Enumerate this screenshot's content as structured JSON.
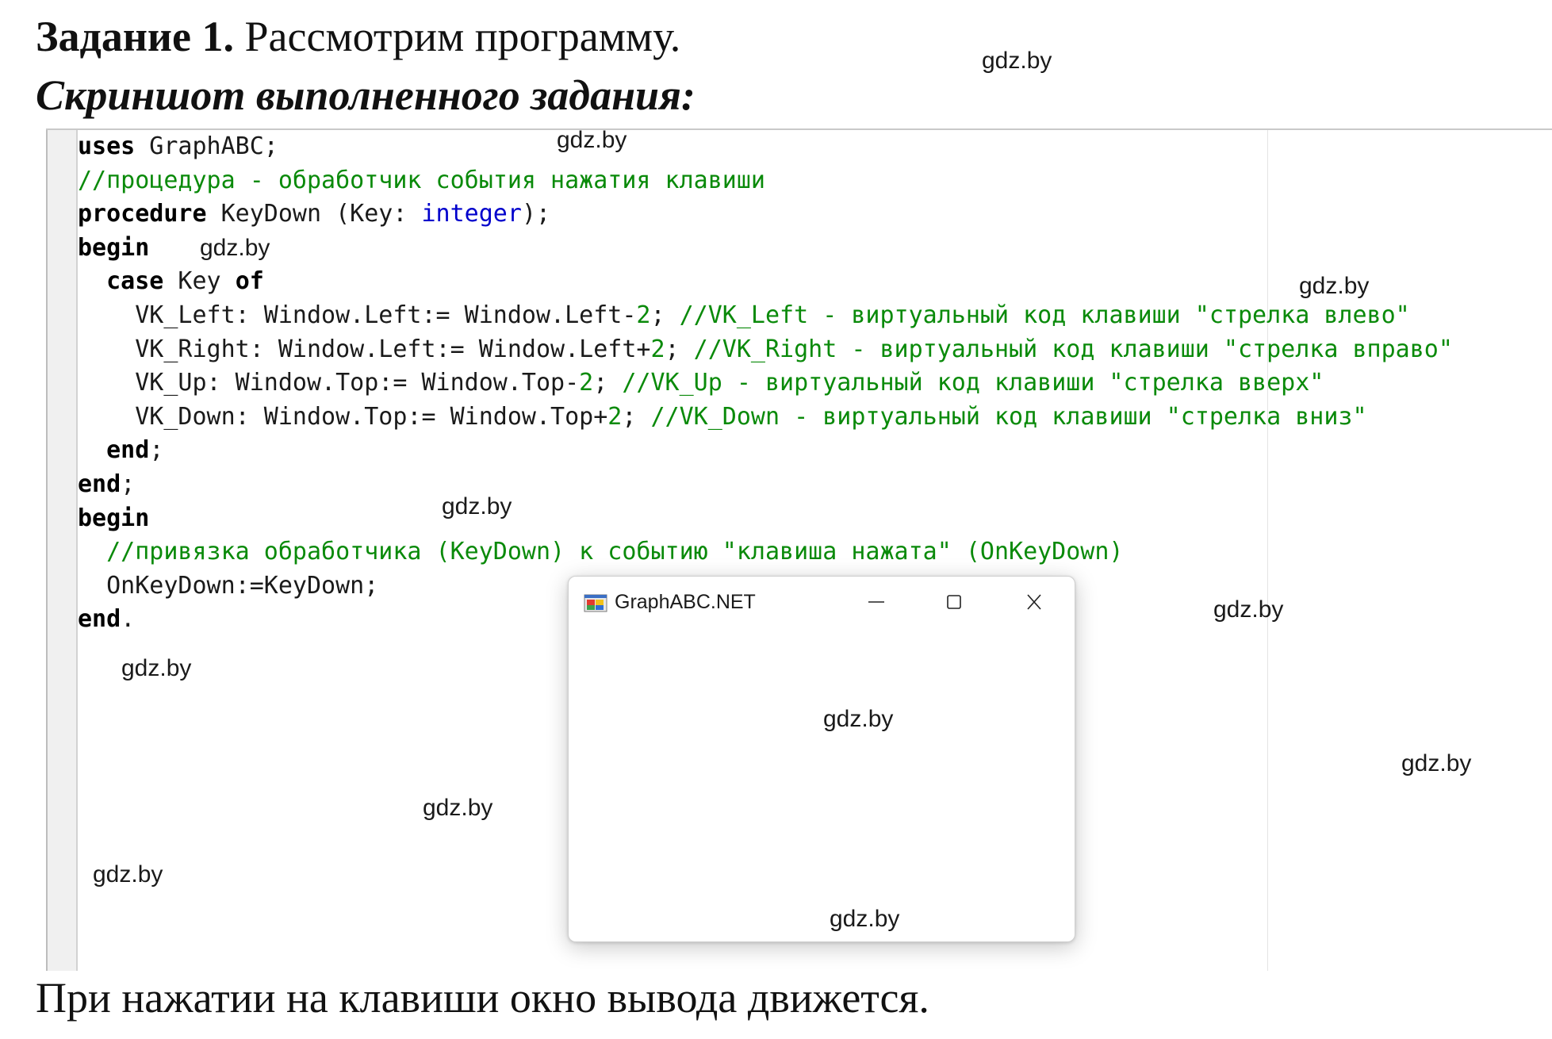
{
  "heading": {
    "task_label": "Задание 1.",
    "task_text": "Рассмотрим программу.",
    "screenshot_label": "Скриншот выполненного задания:"
  },
  "code_lines": [
    [
      {
        "t": "uses",
        "c": "kw"
      },
      {
        "t": " GraphABC;",
        "c": ""
      }
    ],
    [
      {
        "t": "//процедура - обработчик события нажатия клавиши",
        "c": "cm"
      }
    ],
    [
      {
        "t": "procedure",
        "c": "kw"
      },
      {
        "t": " KeyDown (Key: ",
        "c": ""
      },
      {
        "t": "integer",
        "c": "ty"
      },
      {
        "t": ");",
        "c": ""
      }
    ],
    [
      {
        "t": "begin",
        "c": "kw"
      }
    ],
    [
      {
        "t": "  ",
        "c": ""
      },
      {
        "t": "case",
        "c": "kw"
      },
      {
        "t": " Key ",
        "c": ""
      },
      {
        "t": "of",
        "c": "kw"
      }
    ],
    [
      {
        "t": "    VK_Left: Window.Left:= Window.Left-",
        "c": ""
      },
      {
        "t": "2",
        "c": "num"
      },
      {
        "t": "; ",
        "c": ""
      },
      {
        "t": "//VK_Left - виртуальный код клавиши \"стрелка влево\"",
        "c": "cm"
      }
    ],
    [
      {
        "t": "    VK_Right: Window.Left:= Window.Left+",
        "c": ""
      },
      {
        "t": "2",
        "c": "num"
      },
      {
        "t": "; ",
        "c": ""
      },
      {
        "t": "//VK_Right - виртуальный код клавиши \"стрелка вправо\"",
        "c": "cm"
      }
    ],
    [
      {
        "t": "    VK_Up: Window.Top:= Window.Top-",
        "c": ""
      },
      {
        "t": "2",
        "c": "num"
      },
      {
        "t": "; ",
        "c": ""
      },
      {
        "t": "//VK_Up - виртуальный код клавиши \"стрелка вверх\"",
        "c": "cm"
      }
    ],
    [
      {
        "t": "    VK_Down: Window.Top:= Window.Top+",
        "c": ""
      },
      {
        "t": "2",
        "c": "num"
      },
      {
        "t": "; ",
        "c": ""
      },
      {
        "t": "//VK_Down - виртуальный код клавиши \"стрелка вниз\"",
        "c": "cm"
      }
    ],
    [
      {
        "t": "  ",
        "c": ""
      },
      {
        "t": "end",
        "c": "kw"
      },
      {
        "t": ";",
        "c": ""
      }
    ],
    [
      {
        "t": "end",
        "c": "kw"
      },
      {
        "t": ";",
        "c": ""
      }
    ],
    [
      {
        "t": "begin",
        "c": "kw"
      }
    ],
    [
      {
        "t": "  ",
        "c": ""
      },
      {
        "t": "//привязка обработчика (KeyDown) к событию \"клавиша нажата\" (OnKeyDown)",
        "c": "cm"
      }
    ],
    [
      {
        "t": "  OnKeyDown:=KeyDown;",
        "c": ""
      }
    ],
    [
      {
        "t": "end",
        "c": "kw"
      },
      {
        "t": ".",
        "c": ""
      }
    ]
  ],
  "graph_window": {
    "title": "GraphABC.NET",
    "icon": "graphabc-app-icon",
    "controls": [
      "minimize-icon",
      "maximize-icon",
      "close-icon"
    ]
  },
  "footer_text": "При нажатии на клавиши окно вывода движется.",
  "watermark": "gdz.by",
  "colors": {
    "keyword": "#000000",
    "comment": "#0a8a0a",
    "type": "#0000cc",
    "gutter": "#f0f0f0"
  }
}
